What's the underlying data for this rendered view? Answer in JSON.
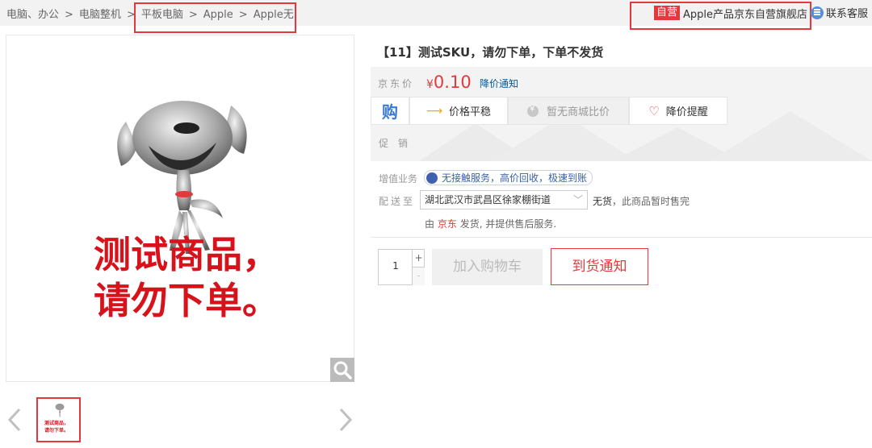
{
  "breadcrumb": {
    "items": [
      "电脑、办公",
      "电脑整机",
      "平板电脑",
      "Apple",
      "Apple无"
    ],
    "separator": ">"
  },
  "shop": {
    "badge": "自营",
    "name": "Apple产品京东自营旗舰店",
    "service_label": "联系客服"
  },
  "gallery": {
    "image_text_line1": "测试商品，",
    "image_text_line2": "请勿下单。",
    "prev_icon": "chevron-left-icon",
    "next_icon": "chevron-right-icon",
    "zoom_icon": "magnifier-icon"
  },
  "product": {
    "title": "【11】测试SKU，请勿下单，下单不发货",
    "price_label": "京东价",
    "currency": "¥",
    "price": "0.10",
    "price_notice": "降价通知",
    "tabs": {
      "gou": "购",
      "stable": "价格平稳",
      "no_compare": "暂无商城比价",
      "reduce_alert": "降价提醒"
    },
    "promo_label": "促销"
  },
  "services": {
    "vas_label": "增值业务",
    "vas_text": "无接触服务，高价回收，极速到账",
    "ship_label": "配送至",
    "address": "湖北武汉市武昌区徐家棚街道",
    "stock_status": "无货",
    "stock_note": "，此商品暂时售完",
    "supplier_prefix": "由",
    "supplier_name": "京东",
    "supplier_suffix": "发货, 并提供售后服务."
  },
  "purchase": {
    "quantity": "1",
    "plus": "+",
    "minus": "-",
    "add_to_cart": "加入购物车",
    "arrival_notice": "到货通知"
  },
  "colors": {
    "accent": "#e4393c",
    "link": "#005aa0"
  }
}
